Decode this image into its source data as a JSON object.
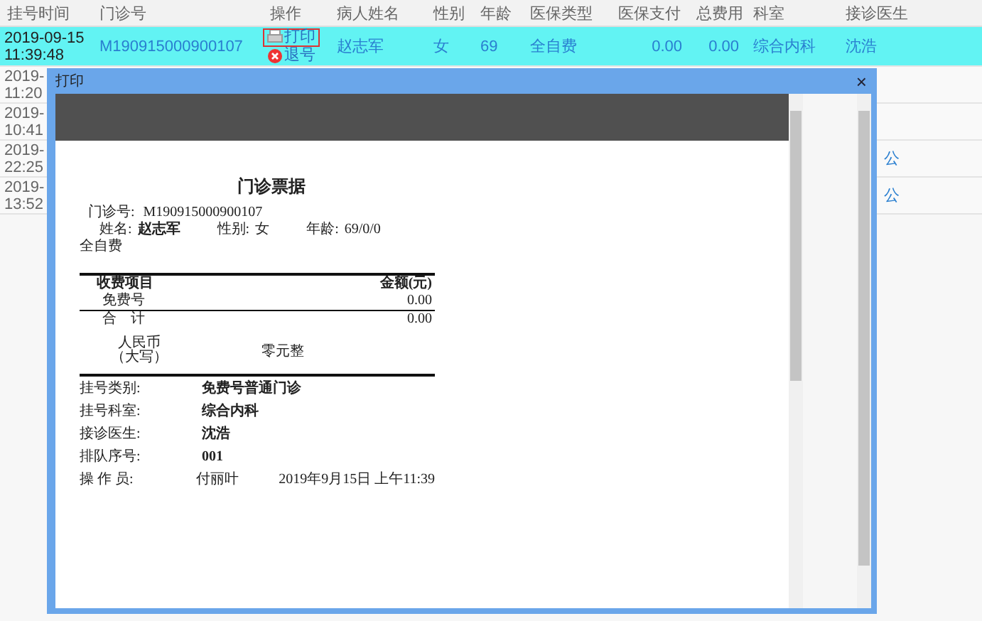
{
  "table": {
    "columns": [
      "挂号时间",
      "门诊号",
      "操作",
      "病人姓名",
      "性别",
      "年龄",
      "医保类型",
      "医保支付",
      "总费用",
      "科室",
      "接诊医生"
    ],
    "rows": [
      {
        "selected": true,
        "time": [
          "2019-09-15",
          "11:39:48"
        ],
        "clinic_no": "M190915000900107",
        "actions": [
          {
            "kind": "print",
            "label": "打印",
            "focused": true
          },
          {
            "kind": "cancel",
            "label": "退号",
            "focused": false
          }
        ],
        "patient": "赵志军",
        "sex": "女",
        "age": "69",
        "insurance": "全自费",
        "insurance_paid": "0.00",
        "total": "0.00",
        "department": "综合内科",
        "doctor": "沈浩"
      },
      {
        "selected": false,
        "time": [
          "2019-",
          "11:20"
        ]
      },
      {
        "selected": false,
        "time": [
          "2019-",
          "10:41"
        ]
      },
      {
        "selected": false,
        "time": [
          "2019-",
          "22:25"
        ],
        "doctor": "公"
      },
      {
        "selected": false,
        "time": [
          "2019-",
          "13:52"
        ],
        "doctor": "公"
      }
    ]
  },
  "dialog": {
    "title": "打印",
    "close": "×",
    "receipt": {
      "title": "门诊票据",
      "clinic_no": {
        "label": "门诊号:",
        "value": "M190915000900107"
      },
      "patient": [
        {
          "label": "姓名:",
          "value": "赵志军",
          "bold": true
        },
        {
          "label": "性别:",
          "value": "女",
          "bold": false
        },
        {
          "label": "年龄:",
          "value": "69/0/0",
          "bold": false
        }
      ],
      "insurance": "全自费",
      "items_header": [
        "收费项目",
        "金额(元)"
      ],
      "items": [
        {
          "name": "免费号",
          "amount": "0.00"
        }
      ],
      "total": {
        "label": "合　计",
        "amount": "0.00"
      },
      "capital": {
        "label": [
          "人民币",
          "（大写）"
        ],
        "value": "零元整"
      },
      "info": [
        {
          "label": "挂号类别:",
          "value": "免费号普通门诊",
          "bold": true
        },
        {
          "label": "挂号科室:",
          "value": "综合内科",
          "bold": true
        },
        {
          "label": "接诊医生:",
          "value": "沈浩",
          "bold": true
        },
        {
          "label": "排队序号:",
          "value": "001",
          "bold": true
        },
        {
          "label": "操 作 员:",
          "value": "付丽叶",
          "bold": false,
          "extra": "2019年9月15日 上午11:39"
        }
      ]
    }
  }
}
